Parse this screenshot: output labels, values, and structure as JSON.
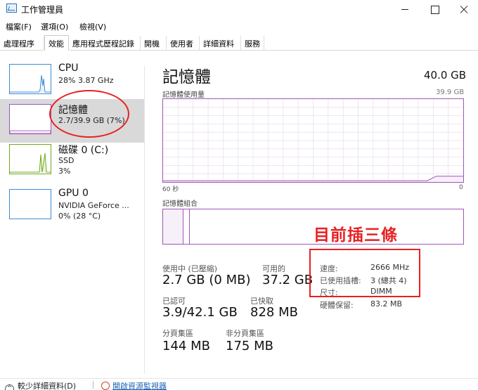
{
  "window": {
    "title": "工作管理員",
    "icon": "task-manager-icon",
    "controls": [
      "minimize",
      "maximize",
      "close"
    ]
  },
  "menu": {
    "file": "檔案(F)",
    "options": "選項(O)",
    "view": "檢視(V)"
  },
  "tabs": [
    "處理程序",
    "效能",
    "應用程式歷程記錄",
    "開機",
    "使用者",
    "詳細資料",
    "服務"
  ],
  "active_tab": "效能",
  "sidebar": {
    "items": [
      {
        "title": "CPU",
        "line1": "28%  3.87 GHz",
        "line2": "",
        "color": "#3d8cd6"
      },
      {
        "title": "記憶體",
        "line1": "2.7/39.9 GB (7%)",
        "line2": "",
        "color": "#9f55b8"
      },
      {
        "title": "磁碟 0 (C:)",
        "line1": "SSD",
        "line2": "3%",
        "color": "#73a61e"
      },
      {
        "title": "GPU 0",
        "line1": "NVIDIA GeForce ...",
        "line2": "0%  (28 °C)",
        "color": "#3d8cd6"
      }
    ]
  },
  "memory": {
    "title": "記憶體",
    "total": "40.0 GB",
    "usage_label": "記憶體使用量",
    "max": "39.9 GB",
    "axis_left": "60 秒",
    "axis_right": "0",
    "composition_label": "記憶體組合",
    "usage_fraction": 0.07,
    "composition_used_fraction": 0.068,
    "composition_modified_fraction": 0.02
  },
  "stats": {
    "in_use_label": "使用中 (已壓縮)",
    "in_use": "2.7 GB (0 MB)",
    "available_label": "可用的",
    "available": "37.2 GB",
    "committed_label": "已認可",
    "committed": "3.9/42.1 GB",
    "cached_label": "已快取",
    "cached": "828 MB",
    "paged_pool_label": "分頁集區",
    "paged_pool": "144 MB",
    "nonpaged_pool_label": "非分頁集區",
    "nonpaged_pool": "175 MB"
  },
  "details": {
    "speed_label": "速度:",
    "speed": "2666 MHz",
    "slots_label": "已使用插槽:",
    "slots": "3 (總共 4)",
    "form_factor_label": "尺寸:",
    "form_factor": "DIMM",
    "hardware_reserved_label": "硬體保留:",
    "hardware_reserved": "83.2 MB"
  },
  "annotation": "目前插三條",
  "bottom": {
    "fewer_details": "較少詳細資料(D)",
    "resource_monitor": "開啟資源監視器"
  },
  "colors": {
    "memory": "#9f55b8",
    "cpu": "#3d8cd6",
    "disk": "#73a61e",
    "annotation": "#e72122"
  }
}
